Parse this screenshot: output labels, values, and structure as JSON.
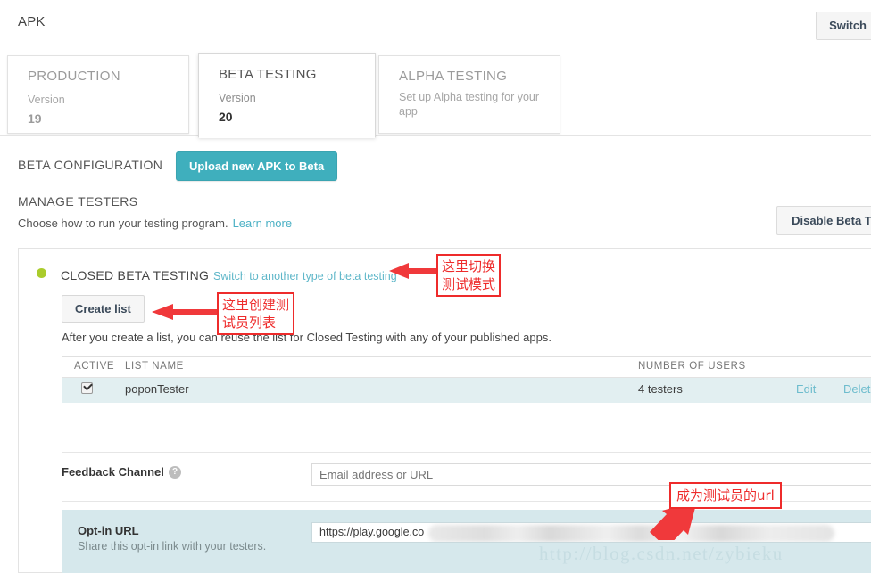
{
  "header": {
    "title": "APK",
    "switch_button": "Switch"
  },
  "tabs": [
    {
      "name": "PRODUCTION",
      "sub": "Version",
      "version": "19",
      "selected": false
    },
    {
      "name": "BETA TESTING",
      "sub": "Version",
      "version": "20",
      "selected": true
    },
    {
      "name": "ALPHA TESTING",
      "sub": "Set up Alpha testing\nfor your app",
      "version": "",
      "selected": false
    }
  ],
  "beta_config": {
    "section_label": "BETA CONFIGURATION",
    "upload_button": "Upload new APK to Beta",
    "manage_testers_label": "MANAGE TESTERS",
    "choose_text": "Choose how to run your testing program.",
    "learn_more": "Learn more",
    "disable_button": "Disable Beta Te"
  },
  "panel": {
    "status_title": "CLOSED BETA TESTING",
    "switch_type_link": "Switch to another type of beta testing",
    "create_list_button": "Create list",
    "helper_text": "After you create a list, you can reuse the list for Closed Testing with any of your published apps.",
    "table": {
      "columns": [
        "ACTIVE",
        "LIST NAME",
        "NUMBER OF USERS"
      ],
      "rows": [
        {
          "active": true,
          "list_name": "poponTester",
          "number_of_users": "4 testers",
          "edit": "Edit",
          "delete": "Delet"
        }
      ]
    },
    "feedback_channel": {
      "label": "Feedback Channel",
      "help_glyph": "?",
      "placeholder": "Email address or URL",
      "value": ""
    },
    "optin": {
      "title": "Opt-in URL",
      "subtitle": "Share this opt-in link with your testers.",
      "value": "https://play.google.co"
    }
  },
  "annotations": [
    {
      "text": "这里切换\n测试模式"
    },
    {
      "text": "这里创建测\n试员列表"
    },
    {
      "text": "成为测试员的url"
    }
  ],
  "watermark": "http://blog.csdn.net/zybieku",
  "colors": {
    "accent_teal": "#3fafbd",
    "link": "#5fb7c9",
    "status_green": "#aacc2c",
    "row_highlight": "#e2eff1",
    "optin_bg": "#d6e8ec",
    "annotation_red": "#ee2b2b"
  }
}
